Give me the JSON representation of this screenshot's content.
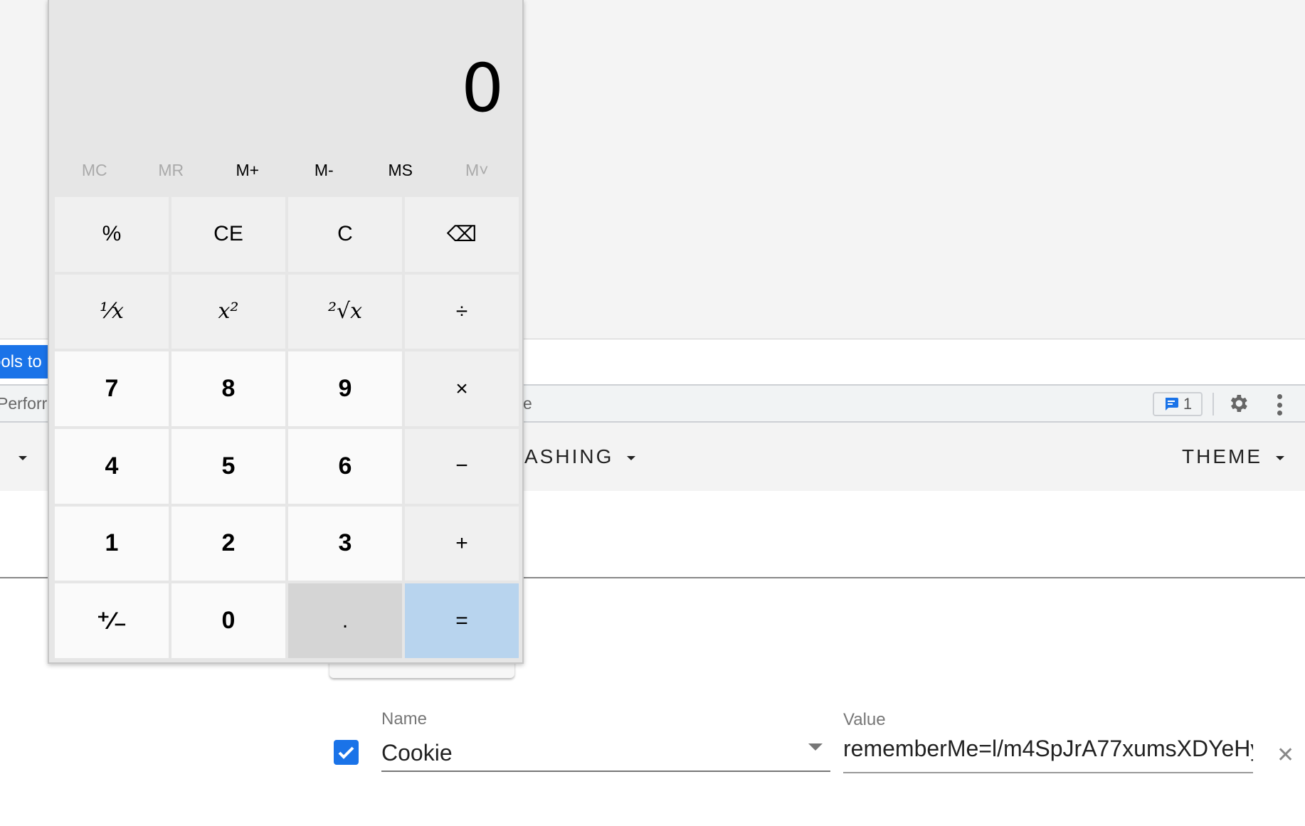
{
  "background_app": {
    "devtools_button_label": "ools to",
    "toolbar": {
      "left_text": "Perforr",
      "mid_text": "e",
      "comment_count": "1"
    },
    "menu": {
      "left_caret": "",
      "dashing_label": "ASHING",
      "theme_label": "THEME"
    },
    "header_row": {
      "checked": true,
      "name_label": "Name",
      "name_value": "Cookie",
      "value_label": "Value",
      "value_value": "rememberMe=l/m4SpJrA77xumsXDYeHy",
      "remove_icon": "close-icon"
    }
  },
  "calculator": {
    "display": "0",
    "memory": [
      {
        "label": "MC",
        "enabled": false
      },
      {
        "label": "MR",
        "enabled": false
      },
      {
        "label": "M+",
        "enabled": true
      },
      {
        "label": "M-",
        "enabled": true
      },
      {
        "label": "MS",
        "enabled": true
      },
      {
        "label": "M˅",
        "enabled": false
      }
    ],
    "keys": [
      {
        "label": "%",
        "type": "op"
      },
      {
        "label": "CE",
        "type": "op"
      },
      {
        "label": "C",
        "type": "op"
      },
      {
        "label": "⌫",
        "type": "op"
      },
      {
        "label": "¹⁄x",
        "type": "math"
      },
      {
        "label": "x²",
        "type": "math"
      },
      {
        "label": "²√x",
        "type": "math"
      },
      {
        "label": "÷",
        "type": "op"
      },
      {
        "label": "7",
        "type": "num"
      },
      {
        "label": "8",
        "type": "num"
      },
      {
        "label": "9",
        "type": "num"
      },
      {
        "label": "×",
        "type": "op"
      },
      {
        "label": "4",
        "type": "num"
      },
      {
        "label": "5",
        "type": "num"
      },
      {
        "label": "6",
        "type": "num"
      },
      {
        "label": "−",
        "type": "op"
      },
      {
        "label": "1",
        "type": "num"
      },
      {
        "label": "2",
        "type": "num"
      },
      {
        "label": "3",
        "type": "num"
      },
      {
        "label": "+",
        "type": "op"
      },
      {
        "label": "⁺⁄₋",
        "type": "num"
      },
      {
        "label": "0",
        "type": "num"
      },
      {
        "label": ".",
        "type": "dot"
      },
      {
        "label": "=",
        "type": "eq"
      }
    ]
  },
  "colors": {
    "accent": "#1a73e8",
    "equals_key": "#b8d4ee"
  }
}
